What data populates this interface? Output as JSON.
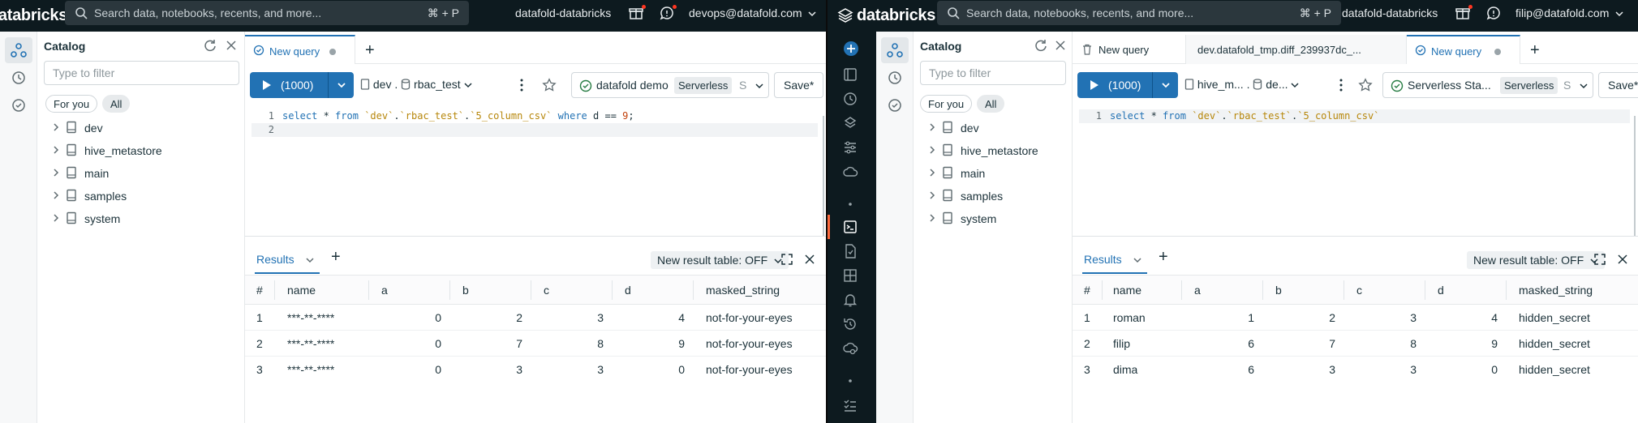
{
  "left": {
    "brand": "databricks",
    "search": {
      "placeholder": "Search data, notebooks, recents, and more...",
      "shortcut": "⌘ + P"
    },
    "workspace": "datafold-databricks",
    "user": "devops@datafold.com",
    "catalog": {
      "title": "Catalog",
      "filter_placeholder": "Type to filter",
      "pills": [
        "For you",
        "All"
      ],
      "items": [
        "dev",
        "hive_metastore",
        "main",
        "samples",
        "system"
      ]
    },
    "tabs": [
      {
        "label": "New query"
      }
    ],
    "toolbar": {
      "run_label": "(1000)",
      "catalog": "dev",
      "schema": "rbac_test",
      "warehouse": "datafold demo",
      "badge": "Serverless",
      "badge_short": "S",
      "save": "Save*"
    },
    "editor": {
      "line_numbers": [
        "1",
        "2"
      ],
      "code": {
        "kw1": "select",
        "star": " * ",
        "kw2": "from",
        "t1": "`dev`",
        "t2": "`rbac_test`",
        "t3": "`5_column_csv`",
        "kw3": "where",
        "col": "d",
        "eq": "==",
        "val": "9",
        "end": ";"
      }
    },
    "results": {
      "tab": "Results",
      "new_result_table": "New result table: OFF",
      "columns": [
        "#",
        "name",
        "a",
        "b",
        "c",
        "d",
        "masked_string"
      ],
      "rows": [
        [
          "1",
          "***-**-****",
          "0",
          "2",
          "3",
          "4",
          "not-for-your-eyes"
        ],
        [
          "2",
          "***-**-****",
          "0",
          "7",
          "8",
          "9",
          "not-for-your-eyes"
        ],
        [
          "3",
          "***-**-****",
          "0",
          "3",
          "3",
          "0",
          "not-for-your-eyes"
        ]
      ]
    }
  },
  "right": {
    "brand": "databricks",
    "search": {
      "placeholder": "Search data, notebooks, recents, and more...",
      "shortcut": "⌘ + P"
    },
    "workspace": "datafold-databricks",
    "user": "filip@datafold.com",
    "catalog": {
      "title": "Catalog",
      "filter_placeholder": "Type to filter",
      "pills": [
        "For you",
        "All"
      ],
      "items": [
        "dev",
        "hive_metastore",
        "main",
        "samples",
        "system"
      ]
    },
    "tabs": [
      {
        "label": "New query"
      },
      {
        "label": "dev.datafold_tmp.diff_239937dc_..."
      },
      {
        "label": "New query"
      }
    ],
    "toolbar": {
      "run_label": "(1000)",
      "catalog": "hive_m...",
      "schema": "de...",
      "warehouse": "Serverless Sta...",
      "badge": "Serverless",
      "badge_short": "S",
      "save": "Save*"
    },
    "editor": {
      "line_numbers": [
        "1"
      ],
      "code": {
        "kw1": "select",
        "star": " * ",
        "kw2": "from",
        "t1": "`dev`",
        "t2": "`rbac_test`",
        "t3": "`5_column_csv`"
      }
    },
    "results": {
      "tab": "Results",
      "new_result_table": "New result table: OFF",
      "columns": [
        "#",
        "name",
        "a",
        "b",
        "c",
        "d",
        "masked_string"
      ],
      "rows": [
        [
          "1",
          "roman",
          "1",
          "2",
          "3",
          "4",
          "hidden_secret"
        ],
        [
          "2",
          "filip",
          "6",
          "7",
          "8",
          "9",
          "hidden_secret"
        ],
        [
          "3",
          "dima",
          "6",
          "3",
          "3",
          "0",
          "hidden_secret"
        ]
      ]
    }
  },
  "icons": {
    "accent": "#2272b4",
    "dark": "#0d1a1f",
    "active_marker": "#ff6a3d"
  }
}
